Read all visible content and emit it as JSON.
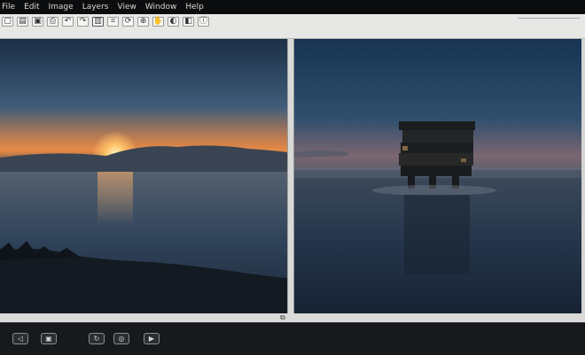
{
  "menu": {
    "items": [
      "File",
      "Edit",
      "Image",
      "Layers",
      "View",
      "Window",
      "Help"
    ]
  },
  "toolbar": {
    "icons": [
      {
        "name": "new-icon",
        "glyph": "▢"
      },
      {
        "name": "open-icon",
        "glyph": "▤"
      },
      {
        "name": "save-icon",
        "glyph": "▣"
      },
      {
        "name": "print-icon",
        "glyph": "⎙"
      },
      {
        "name": "undo-icon",
        "glyph": "↶"
      },
      {
        "name": "redo-icon",
        "glyph": "↷"
      },
      {
        "name": "compare-icon",
        "glyph": "▥"
      },
      {
        "name": "crop-icon",
        "glyph": "⌗"
      },
      {
        "name": "rotate-icon",
        "glyph": "⟳"
      },
      {
        "name": "zoom-icon",
        "glyph": "⊕"
      },
      {
        "name": "hand-icon",
        "glyph": "✋"
      },
      {
        "name": "color-icon",
        "glyph": "◐"
      },
      {
        "name": "levels-icon",
        "glyph": "◧"
      },
      {
        "name": "info-icon",
        "glyph": "ⓘ"
      }
    ]
  },
  "colors": {
    "sky_top": "#1d3148",
    "sky_horizon": "#e7894a",
    "sun": "#ffd88a",
    "water": "#2c3f57",
    "foreground": "#141a20",
    "night_sky": "#1b3552",
    "tower": "#1a1c1f"
  },
  "bottom": {
    "buttons": [
      {
        "name": "prev-icon",
        "glyph": "◁"
      },
      {
        "name": "fit-icon",
        "glyph": "▣"
      },
      {
        "name": "rotate-icon",
        "glyph": "↻"
      },
      {
        "name": "flag-icon",
        "glyph": "◎"
      },
      {
        "name": "play-icon",
        "glyph": "▶"
      }
    ]
  }
}
